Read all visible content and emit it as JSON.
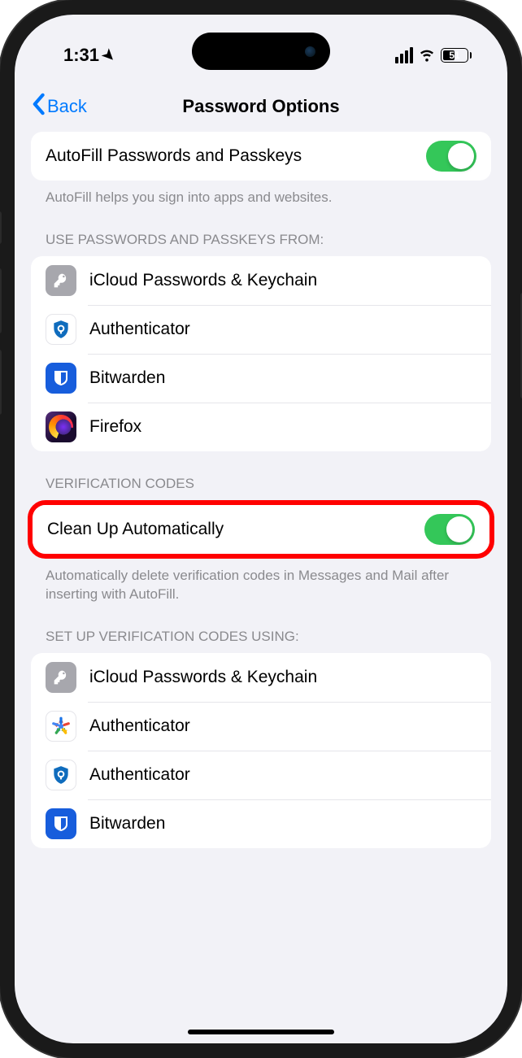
{
  "status_bar": {
    "time": "1:31",
    "battery_percent": "51"
  },
  "nav": {
    "back_label": "Back",
    "title": "Password Options"
  },
  "autofill": {
    "label": "AutoFill Passwords and Passkeys",
    "footer": "AutoFill helps you sign into apps and websites."
  },
  "sources": {
    "header": "USE PASSWORDS AND PASSKEYS FROM:",
    "items": [
      {
        "label": "iCloud Passwords & Keychain"
      },
      {
        "label": "Authenticator"
      },
      {
        "label": "Bitwarden"
      },
      {
        "label": "Firefox"
      }
    ]
  },
  "verification": {
    "header": "VERIFICATION CODES",
    "cleanup_label": "Clean Up Automatically",
    "footer": "Automatically delete verification codes in Messages and Mail after inserting with AutoFill."
  },
  "setup": {
    "header": "SET UP VERIFICATION CODES USING:",
    "items": [
      {
        "label": "iCloud Passwords & Keychain"
      },
      {
        "label": "Authenticator"
      },
      {
        "label": "Authenticator"
      },
      {
        "label": "Bitwarden"
      }
    ]
  }
}
